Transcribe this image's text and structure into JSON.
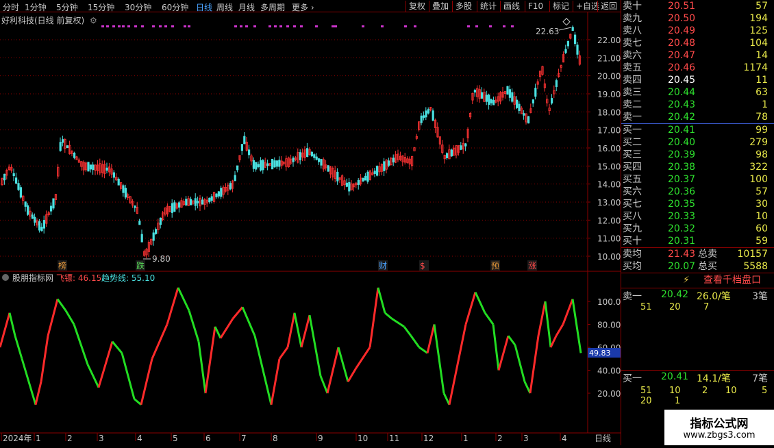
{
  "toolbar": {
    "periods": [
      "分时",
      "1分钟",
      "5分钟",
      "15分钟",
      "30分钟",
      "60分钟",
      "日线",
      "周线",
      "月线",
      "多周期",
      "更多"
    ],
    "active_period": "日线",
    "tools": [
      "复权",
      "叠加",
      "多股",
      "统计",
      "画线",
      "F10",
      "标记",
      "+自选",
      "返回"
    ]
  },
  "chart": {
    "title": "好利科技(日线 前复权)",
    "price_axis": [
      "22.00",
      "21.00",
      "20.00",
      "19.00",
      "18.00",
      "17.00",
      "16.00",
      "15.00",
      "14.00",
      "13.00",
      "12.00",
      "11.00",
      "10.00"
    ],
    "high_label": "22.63",
    "low_label": "9.80",
    "event_markers": [
      "榜",
      "跌",
      "财",
      "$",
      "预",
      "涨"
    ],
    "indicator_title": "股朋指标网",
    "indicator_line1": "飞镖: 46.15",
    "indicator_line2": "趋势线: 55.10",
    "indicator_axis": [
      "100.00",
      "80.00",
      "60.00",
      "40.00",
      "20.00"
    ],
    "indicator_current": "49.83",
    "time_axis": [
      "2024年",
      "1",
      "2",
      "3",
      "4",
      "5",
      "6",
      "7",
      "8",
      "9",
      "10",
      "11",
      "12",
      "1",
      "2",
      "3",
      "4"
    ],
    "period_label": "日线",
    "colors": {
      "up": "#ff3333",
      "down": "#22dd22",
      "grid": "#8b0000",
      "markers": "#cc33cc"
    }
  },
  "orderbook": {
    "sell": [
      {
        "label": "卖十",
        "price": "20.51",
        "vol": "57",
        "color": "red"
      },
      {
        "label": "卖九",
        "price": "20.50",
        "vol": "194",
        "color": "red"
      },
      {
        "label": "卖八",
        "price": "20.49",
        "vol": "125",
        "color": "red"
      },
      {
        "label": "卖七",
        "price": "20.48",
        "vol": "104",
        "color": "red"
      },
      {
        "label": "卖六",
        "price": "20.47",
        "vol": "14",
        "color": "red"
      },
      {
        "label": "卖五",
        "price": "20.46",
        "vol": "1174",
        "color": "red"
      },
      {
        "label": "卖四",
        "price": "20.45",
        "vol": "11",
        "color": "white"
      },
      {
        "label": "卖三",
        "price": "20.44",
        "vol": "63",
        "color": "green"
      },
      {
        "label": "卖二",
        "price": "20.43",
        "vol": "1",
        "color": "green"
      },
      {
        "label": "卖一",
        "price": "20.42",
        "vol": "78",
        "color": "green"
      }
    ],
    "buy": [
      {
        "label": "买一",
        "price": "20.41",
        "vol": "99",
        "color": "green"
      },
      {
        "label": "买二",
        "price": "20.40",
        "vol": "279",
        "color": "green"
      },
      {
        "label": "买三",
        "price": "20.39",
        "vol": "98",
        "color": "green"
      },
      {
        "label": "买四",
        "price": "20.38",
        "vol": "322",
        "color": "green"
      },
      {
        "label": "买五",
        "price": "20.37",
        "vol": "100",
        "color": "green"
      },
      {
        "label": "买六",
        "price": "20.36",
        "vol": "57",
        "color": "green"
      },
      {
        "label": "买七",
        "price": "20.35",
        "vol": "30",
        "color": "green"
      },
      {
        "label": "买八",
        "price": "20.33",
        "vol": "10",
        "color": "green"
      },
      {
        "label": "买九",
        "price": "20.32",
        "vol": "60",
        "color": "green"
      },
      {
        "label": "买十",
        "price": "20.31",
        "vol": "59",
        "color": "green"
      }
    ],
    "avg_sell": {
      "label": "卖均",
      "price": "21.43",
      "total_label": "总卖",
      "total": "10157"
    },
    "avg_buy": {
      "label": "买均",
      "price": "20.07",
      "total_label": "总买",
      "total": "5588"
    },
    "view_button": "查看千档盘口",
    "sell_detail": {
      "label": "卖一",
      "price": "20.42",
      "amount": "26.0/笔",
      "count": "3笔",
      "queue": [
        "51",
        "20",
        "7"
      ]
    },
    "buy_detail": {
      "label": "买一",
      "price": "20.41",
      "amount": "14.1/笔",
      "count": "7笔",
      "queue1": [
        "51",
        "10",
        "2",
        "10",
        "5"
      ],
      "queue2": [
        "20",
        "1"
      ]
    }
  },
  "watermark": {
    "title": "指标公式网",
    "url": "www.zbgs3.com"
  }
}
